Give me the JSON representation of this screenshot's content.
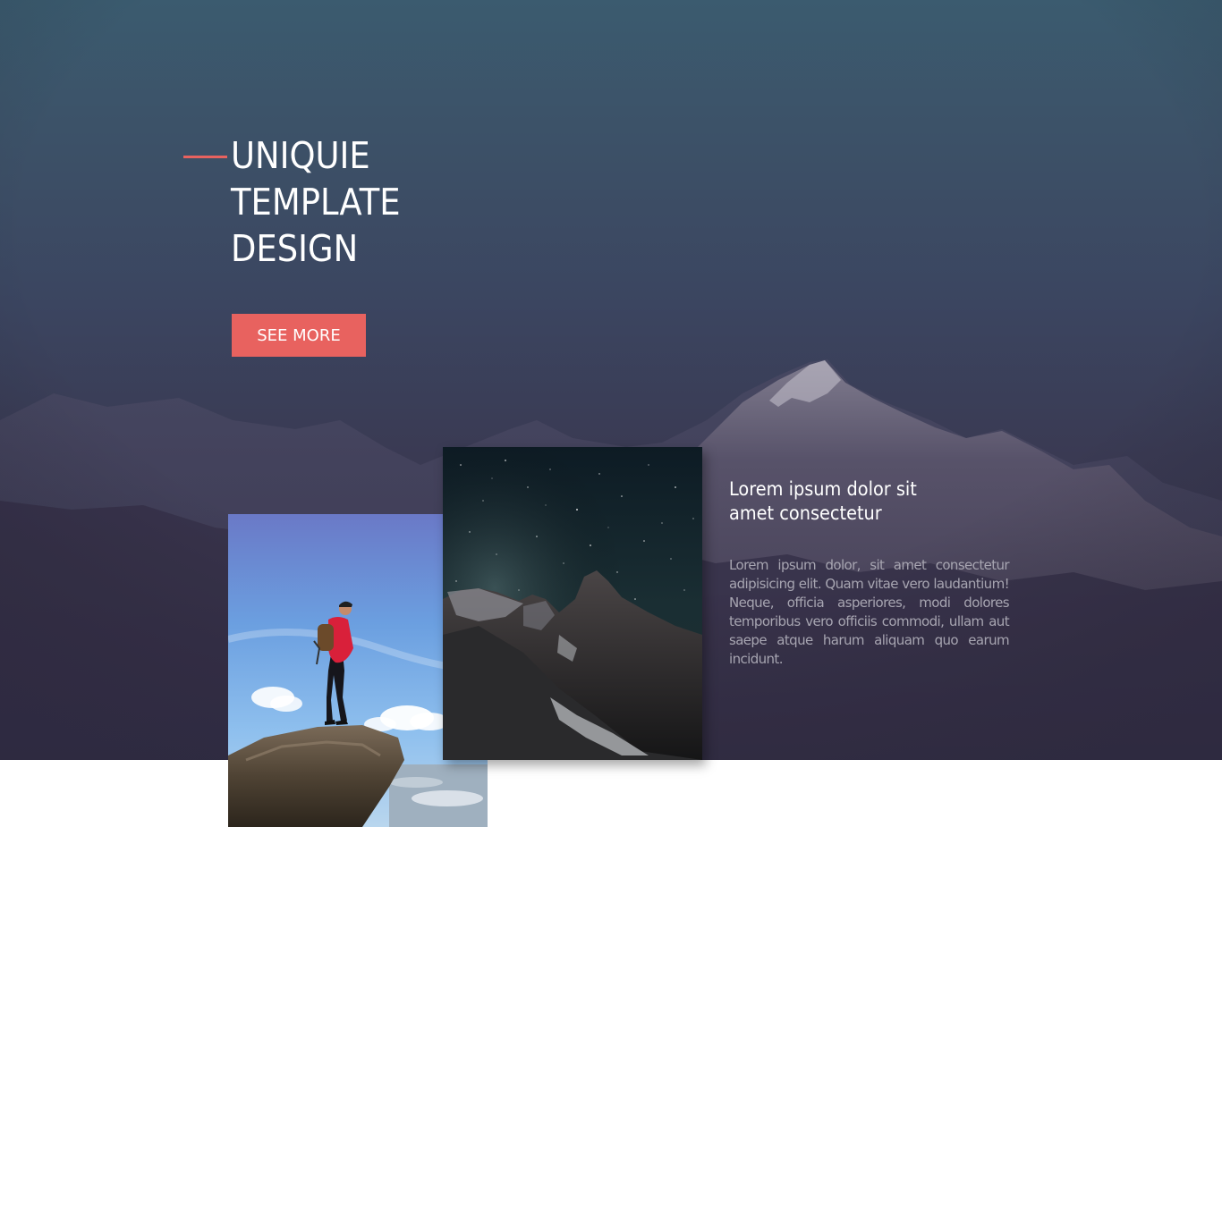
{
  "hero": {
    "title_lines": [
      "UNIQUIE",
      "TEMPLATE",
      "DESIGN"
    ],
    "button_label": "SEE MORE"
  },
  "feature": {
    "heading_lines": [
      "Lorem ipsum dolor sit",
      "amet consectetur"
    ],
    "body": "Lorem ipsum dolor, sit amet consectetur adipisicing elit. Quam vitae vero laudantium! Neque, officia asperiores, modi dolores temporibus vero officiis commodi, ullam aut saepe atque harum aliquam quo earum incidunt."
  },
  "colors": {
    "accent": "#e8625f",
    "hero_top": "#3b5b6f",
    "hero_bottom": "#383349",
    "body_text": "#a7a5b1"
  },
  "images": {
    "hiker_photo": "hiker-on-rock-photo",
    "night_photo": "starry-mountain-photo"
  }
}
